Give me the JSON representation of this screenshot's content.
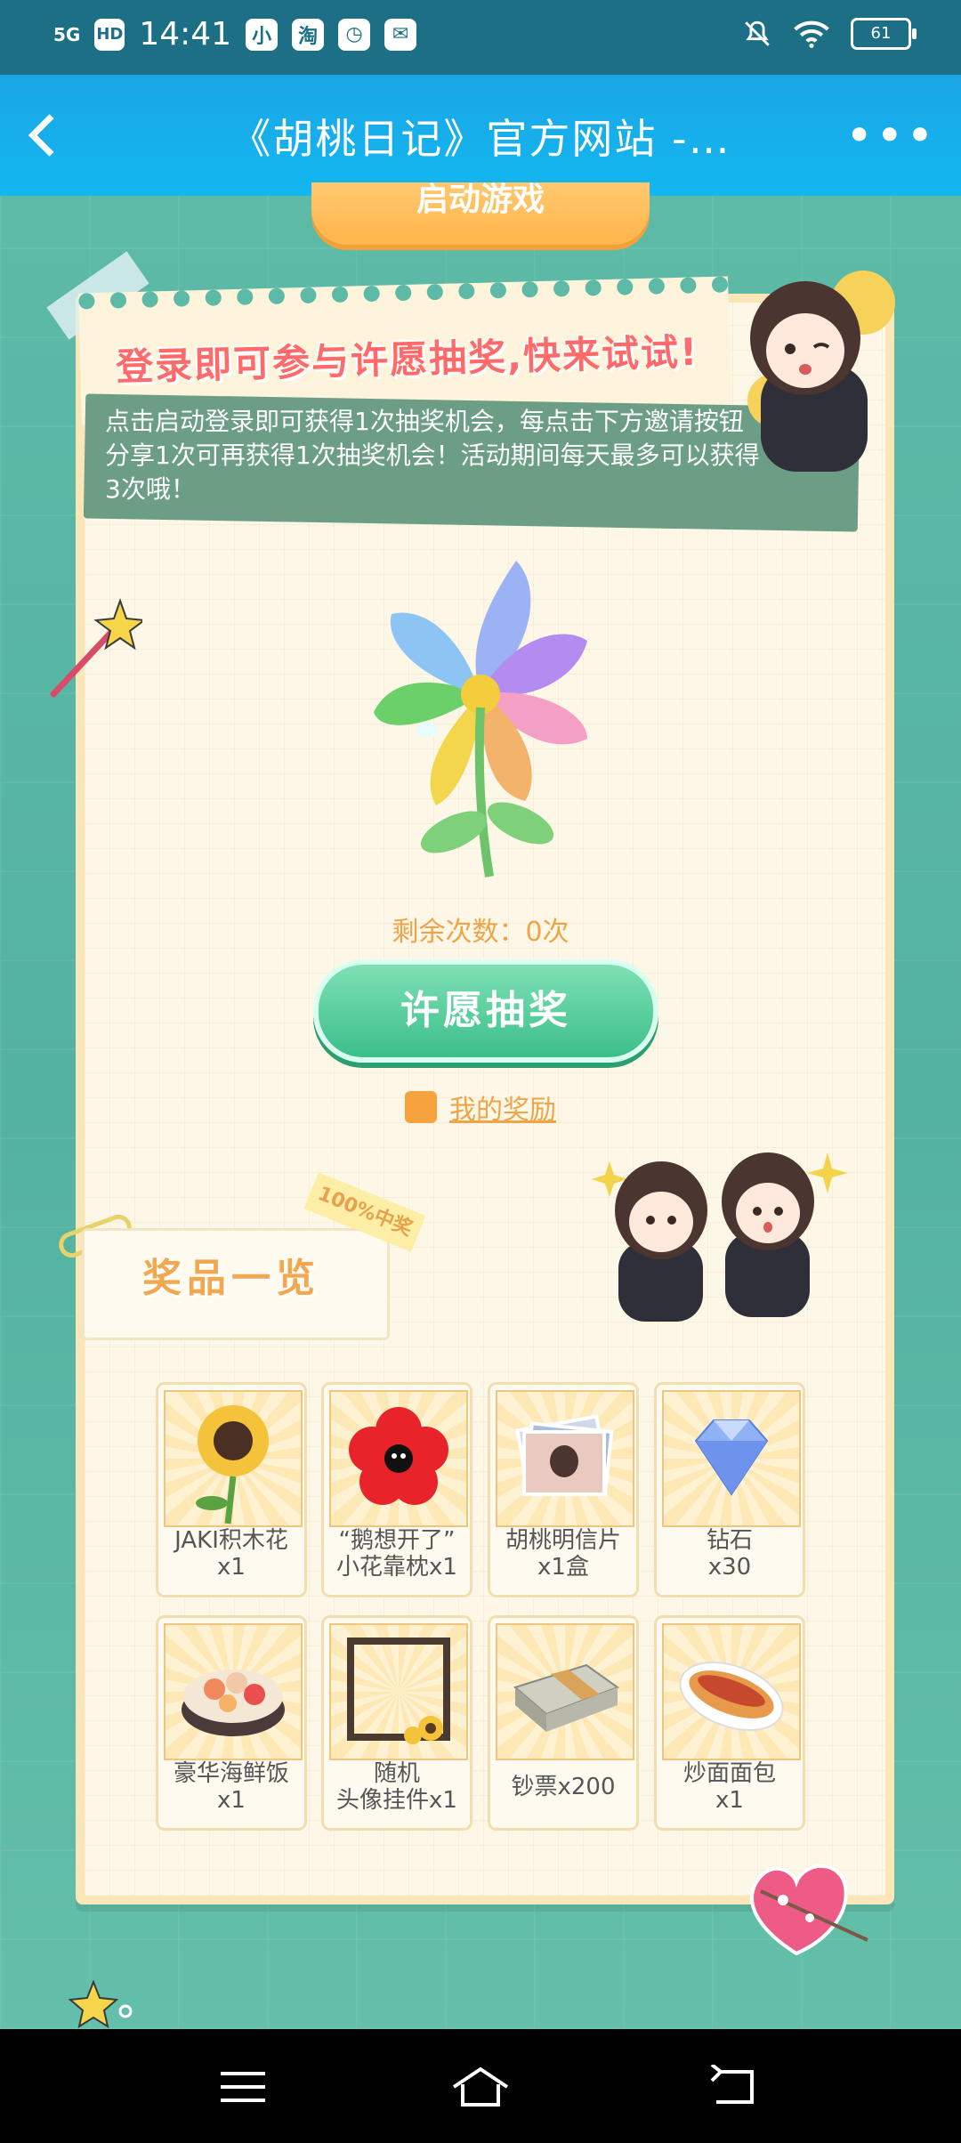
{
  "status_bar": {
    "network": "5G",
    "hd": "HD",
    "time": "14:41",
    "app_icons": [
      "小",
      "淘",
      "◷",
      "✉"
    ],
    "battery": "61"
  },
  "header": {
    "title": "《胡桃日记》官方网站 -…"
  },
  "top_button": {
    "label": "启动游戏"
  },
  "banner": {
    "title": "登录即可参与许愿抽奖,快来试试!",
    "description": "点击启动登录即可获得1次抽奖机会，每点击下方邀请按钮分享1次可再获得1次抽奖机会！活动期间每天最多可以获得3次哦！"
  },
  "lottery": {
    "remaining": "剩余次数：0次",
    "wish_button": "许愿抽奖",
    "my_rewards": "我的奖励"
  },
  "prizes": {
    "title": "奖品一览",
    "ribbon": "100%中奖",
    "items": [
      {
        "line1": "JAKI积木花",
        "line2": "x1",
        "icon": "sunflower-icon"
      },
      {
        "line1": "“鹅想开了”",
        "line2": "小花靠枕x1",
        "icon": "red-flower-pillow-icon"
      },
      {
        "line1": "胡桃明信片",
        "line2": "x1盒",
        "icon": "postcards-icon"
      },
      {
        "line1": "钻石",
        "line2": "x30",
        "icon": "diamond-icon"
      },
      {
        "line1": "豪华海鲜饭",
        "line2": "x1",
        "icon": "seafood-rice-icon"
      },
      {
        "line1": "随机",
        "line2": "头像挂件x1",
        "icon": "avatar-frame-icon"
      },
      {
        "line1": "钞票x200",
        "line2": "",
        "icon": "cash-stack-icon"
      },
      {
        "line1": "炒面面包",
        "line2": "x1",
        "icon": "hotdog-bun-icon"
      }
    ]
  },
  "colors": {
    "header": "#13b7f0",
    "status_bar": "#1d6f86",
    "accent_orange": "#f0a447",
    "wish_green": "#3cbf8a",
    "banner_red": "#ff6b6b"
  }
}
